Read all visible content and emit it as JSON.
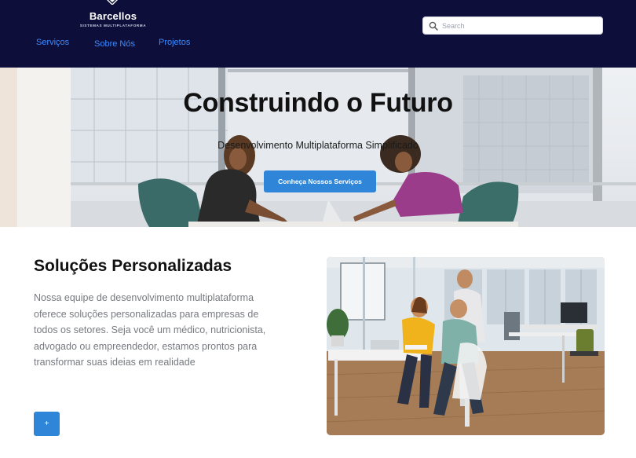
{
  "brand": {
    "name": "Barcellos",
    "tagline": "SISTEMAS MULTIPLATAFORMA"
  },
  "nav": {
    "items": [
      {
        "label": "Serviços"
      },
      {
        "label": "Sobre Nós"
      },
      {
        "label": "Projetos"
      }
    ]
  },
  "search": {
    "placeholder": "Search",
    "value": ""
  },
  "hero": {
    "title": "Construindo o Futuro",
    "subtitle": "Desenvolvimento Multiplataforma Simplificado",
    "cta_label": "Conheça Nossos Serviços"
  },
  "solutions": {
    "title": "Soluções Personalizadas",
    "description": "Nossa equipe de desenvolvimento multiplataforma oferece soluções personalizadas para empresas de todos os setores. Seja você um médico, nutricionista, advogado ou empreendedor, estamos prontos para transformar suas ideias em realidade",
    "button_label": "+"
  },
  "colors": {
    "header_bg": "#0d0f3a",
    "nav_link": "#3d8bff",
    "accent": "#2f86d8"
  }
}
